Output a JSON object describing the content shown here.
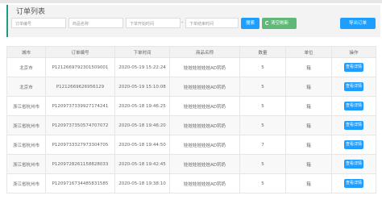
{
  "page": {
    "title": "订单列表"
  },
  "filters": {
    "order_no": "订单编号",
    "product_name": "商品名称",
    "start_time": "下单开始时间",
    "range_sep": "-",
    "end_time": "下单结束时间"
  },
  "buttons": {
    "search": "搜索",
    "clear": "清空刷新",
    "export": "导出订单"
  },
  "table": {
    "headers": [
      "城市",
      "订单编号",
      "下单时间",
      "商品名称",
      "数量",
      "单位",
      "操作"
    ],
    "rows": [
      {
        "city": "北京市",
        "order_no": "P1212669792301509001",
        "time": "2020-05-19 15:22:24",
        "product": "娃娃娃娃娃娃AD钙奶",
        "qty": "5",
        "unit": "箱",
        "action": "查看详情"
      },
      {
        "city": "北京市",
        "order_no": "P1212669626956129",
        "time": "2020-05-19 15:10:08",
        "product": "娃娃娃娃娃娃AD钙奶",
        "qty": "5",
        "unit": "箱",
        "action": "查看详情"
      },
      {
        "city": "浙江省杭州市",
        "order_no": "P1209737339927174241",
        "time": "2020-05-18 19:46:25",
        "product": "娃娃娃娃娃娃AD钙奶",
        "qty": "5",
        "unit": "箱",
        "action": "查看详情"
      },
      {
        "city": "浙江省杭州市",
        "order_no": "P1209737350574707072",
        "time": "2020-05-18 19:46:20",
        "product": "娃娃娃娃娃娃AD钙奶",
        "qty": "5",
        "unit": "箱",
        "action": "查看详情"
      },
      {
        "city": "浙江省杭州市",
        "order_no": "P1209733327973304705",
        "time": "2020-05-18 19:44:50",
        "product": "娃娃娃娃娃娃AD钙奶",
        "qty": "7",
        "unit": "箱",
        "action": "查看详情"
      },
      {
        "city": "浙江省杭州市",
        "order_no": "P1209728261158828033",
        "time": "2020-05-18 19:42:45",
        "product": "娃娃娃娃娃娃AD钙奶",
        "qty": "5",
        "unit": "箱",
        "action": "查看详情"
      },
      {
        "city": "浙江省杭州市",
        "order_no": "P1209716734485831585",
        "time": "2020-05-18 19:38:10",
        "product": "娃娃娃娃娃娃AD钙奶",
        "qty": "5",
        "unit": "箱",
        "action": "查看详情"
      }
    ]
  }
}
